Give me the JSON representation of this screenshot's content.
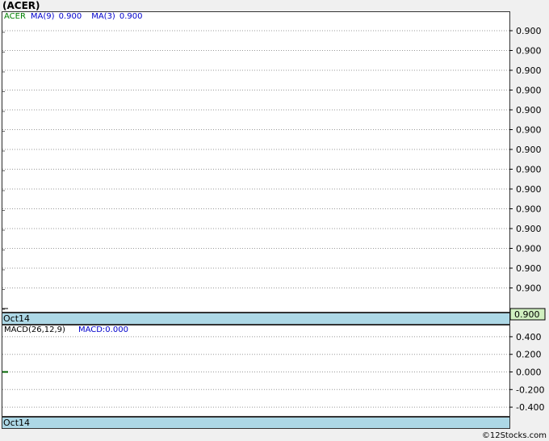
{
  "title": "(ACER)",
  "credit": "12Stocks.com",
  "credit_symbol": "©",
  "colors": {
    "ticker": "#008000",
    "ma": "#0000cc",
    "macd": "#0000cc",
    "panel_strip": "#add8e6",
    "price_box": "#d0f0c0",
    "grid": "#999999"
  },
  "main_legend": {
    "ticker": "ACER",
    "ma9_label": "MA(9)",
    "ma9_value": "0.900",
    "ma3_label": "MA(3)",
    "ma3_value": "0.900"
  },
  "macd_legend": {
    "label": "MACD(26,12,9)",
    "value_label": "MACD:0.000"
  },
  "date_label": "Oct14",
  "current_price": "0.900",
  "chart_data": [
    {
      "type": "line",
      "name_printed": "ACER",
      "y_tick_labels": [
        "0.900",
        "0.900",
        "0.900",
        "0.900",
        "0.900",
        "0.900",
        "0.900",
        "0.900",
        "0.900",
        "0.900",
        "0.900",
        "0.900",
        "0.900",
        "0.900"
      ],
      "x_tick_labels": [
        "Oct14"
      ],
      "series": [
        {
          "name": "ACER",
          "values": [
            0.9
          ]
        },
        {
          "name": "MA(9)",
          "values": [
            0.9
          ]
        },
        {
          "name": "MA(3)",
          "values": [
            0.9
          ]
        }
      ],
      "grid": true,
      "axis_side": "right"
    },
    {
      "type": "line",
      "name_printed": "MACD(26,12,9)",
      "y_ticks": [
        0.4,
        0.2,
        0.0,
        -0.2,
        -0.4
      ],
      "y_tick_labels": [
        "0.400",
        "0.200",
        "0.000",
        "-0.200",
        "-0.400"
      ],
      "ylim": [
        -0.5,
        0.5
      ],
      "x_tick_labels": [
        "Oct14"
      ],
      "series": [
        {
          "name": "MACD",
          "values": [
            0.0
          ]
        }
      ],
      "grid": true,
      "axis_side": "right"
    }
  ]
}
